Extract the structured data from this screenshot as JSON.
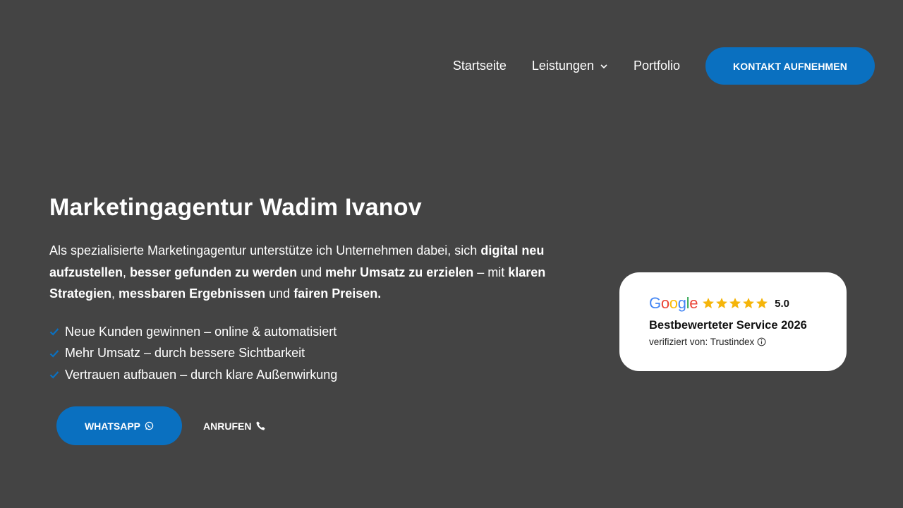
{
  "nav": {
    "items": [
      {
        "label": "Startseite"
      },
      {
        "label": "Leistungen"
      },
      {
        "label": "Portfolio"
      }
    ],
    "cta_label": "KONTAKT AUFNEHMEN"
  },
  "hero": {
    "title": "Marketingagentur Wadim Ivanov",
    "text": [
      {
        "t": "Als spezialisierte Marketingagentur unterstütze ich Unternehmen dabei, sich ",
        "b": false
      },
      {
        "t": "digital neu aufzustellen",
        "b": true
      },
      {
        "t": ", ",
        "b": false
      },
      {
        "t": "besser gefunden zu werden",
        "b": true
      },
      {
        "t": " und ",
        "b": false
      },
      {
        "t": "mehr Umsatz zu erzielen",
        "b": true
      },
      {
        "t": " – mit ",
        "b": false
      },
      {
        "t": "klaren Strategien",
        "b": true
      },
      {
        "t": ", ",
        "b": false
      },
      {
        "t": "messbaren Ergebnissen",
        "b": true
      },
      {
        "t": " und ",
        "b": false
      },
      {
        "t": "fairen Preisen.",
        "b": true
      }
    ],
    "checklist": [
      "Neue Kunden gewinnen – online & automatisiert",
      "Mehr Umsatz – durch bessere Sichtbarkeit",
      "Vertrauen aufbauen – durch klare Außenwirkung"
    ],
    "whatsapp_label": "WHATSAPP",
    "call_label": "ANRUFEN"
  },
  "review": {
    "provider": "Google",
    "rating": "5.0",
    "stars": 5,
    "title": "Bestbewerteter Service 2026",
    "subtitle": "verifiziert von: Trustindex"
  },
  "colors": {
    "background": "#444444",
    "accent": "#0a70c0",
    "star": "#F5B50A"
  },
  "icons": [
    "chevron-down-icon",
    "check-icon",
    "whatsapp-icon",
    "phone-icon",
    "star-icon",
    "info-icon"
  ]
}
